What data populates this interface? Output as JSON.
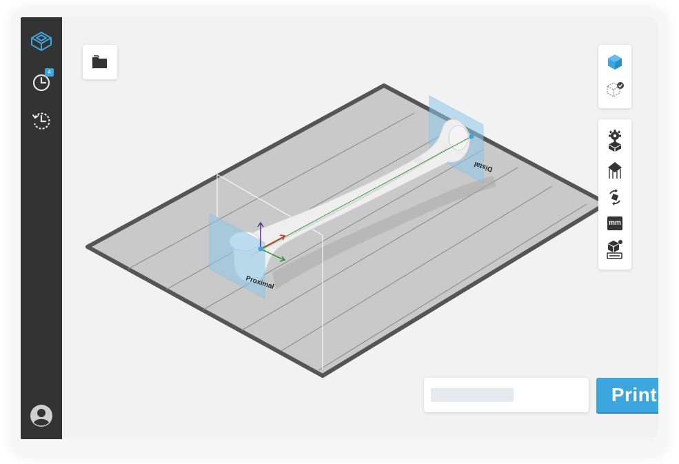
{
  "sidebar": {
    "items": [
      {
        "name": "models",
        "icon": "cube-outline-icon"
      },
      {
        "name": "print-queue",
        "icon": "clock-icon",
        "badge": "4"
      },
      {
        "name": "history",
        "icon": "history-icon"
      }
    ],
    "account_icon": "user-avatar-icon"
  },
  "toolbar": {
    "open_icon": "folder-icon"
  },
  "view_tools": {
    "items": [
      {
        "name": "model-view",
        "icon": "solid-cube-icon"
      },
      {
        "name": "support-view",
        "icon": "wireframe-cube-check-icon"
      }
    ]
  },
  "edit_tools": {
    "items": [
      {
        "name": "auto-setup",
        "icon": "gear-cube-icon"
      },
      {
        "name": "supports",
        "icon": "support-house-icon"
      },
      {
        "name": "orientation",
        "icon": "rotate-arrows-icon"
      },
      {
        "name": "units",
        "icon": "mm-icon",
        "label": "mm"
      },
      {
        "name": "layout",
        "icon": "cube-on-plate-icon"
      }
    ]
  },
  "scene": {
    "tag_proximal": "Proximal",
    "tag_distal": "Distal"
  },
  "job": {
    "name_value": "",
    "placeholder": ""
  },
  "print_button": {
    "label": "Print"
  },
  "colors": {
    "accent": "#3ea6df",
    "sidebar": "#333333",
    "background": "#f2f2f2",
    "build_plate": "#c9c9c9",
    "plate_border": "#555555"
  }
}
